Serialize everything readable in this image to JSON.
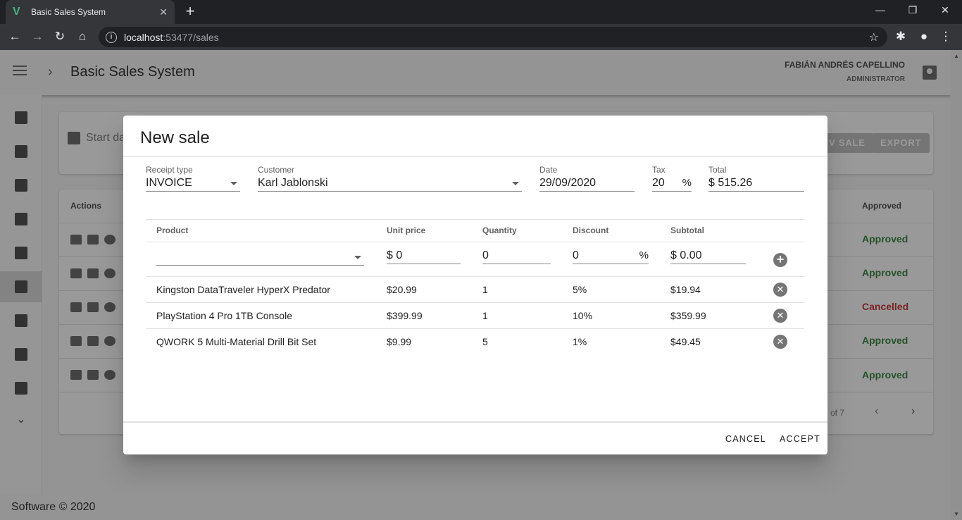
{
  "browser": {
    "tab_title": "Basic Sales System",
    "tab_favicon": "V",
    "url_host": "localhost",
    "url_path": ":53477/sales"
  },
  "app": {
    "title": "Basic Sales System",
    "user_name": "FABIÁN ANDRÉS CAPELLINO",
    "user_role": "ADMINISTRATOR",
    "footer": "Software © 2020"
  },
  "sidenav_icons": [
    "home-icon",
    "image-icon",
    "box-icon",
    "cart-icon",
    "archive-icon",
    "money-icon",
    "people-icon",
    "account-box-icon",
    "clipboard-alert-icon",
    "chevron-down-icon"
  ],
  "filters": {
    "start_date_placeholder": "Start da",
    "new_sale_label": "V SALE",
    "export_label": "EXPORT"
  },
  "sales_table": {
    "actions_header": "Actions",
    "approved_header": "Approved",
    "rows": [
      {
        "status": "Approved",
        "color": "#2e7d32"
      },
      {
        "status": "Approved",
        "color": "#2e7d32"
      },
      {
        "status": "Cancelled",
        "color": "#c62828"
      },
      {
        "status": "Approved",
        "color": "#2e7d32"
      },
      {
        "status": "Approved",
        "color": "#2e7d32"
      }
    ],
    "pager_text": "of 7"
  },
  "dialog": {
    "title": "New sale",
    "receipt_type": {
      "label": "Receipt type",
      "value": "INVOICE"
    },
    "customer": {
      "label": "Customer",
      "value": "Karl Jablonski"
    },
    "date": {
      "label": "Date",
      "value": "29/09/2020"
    },
    "tax": {
      "label": "Tax",
      "value": "20",
      "suffix": "%"
    },
    "total": {
      "label": "Total",
      "value": "$ 515.26"
    },
    "columns": {
      "product": "Product",
      "unit_price": "Unit price",
      "quantity": "Quantity",
      "discount": "Discount",
      "subtotal": "Subtotal"
    },
    "new_line": {
      "product": "",
      "unit_price": "$ 0",
      "quantity": "0",
      "discount": "0",
      "discount_suffix": "%",
      "subtotal": "$ 0.00"
    },
    "items": [
      {
        "product": "Kingston DataTraveler HyperX Predator",
        "unit_price": "$20.99",
        "quantity": "1",
        "discount": "5%",
        "subtotal": "$19.94"
      },
      {
        "product": "PlayStation 4 Pro 1TB Console",
        "unit_price": "$399.99",
        "quantity": "1",
        "discount": "10%",
        "subtotal": "$359.99"
      },
      {
        "product": "QWORK 5 Multi-Material Drill Bit Set",
        "unit_price": "$9.99",
        "quantity": "5",
        "discount": "1%",
        "subtotal": "$49.45"
      }
    ],
    "cancel_label": "CANCEL",
    "accept_label": "ACCEPT"
  }
}
